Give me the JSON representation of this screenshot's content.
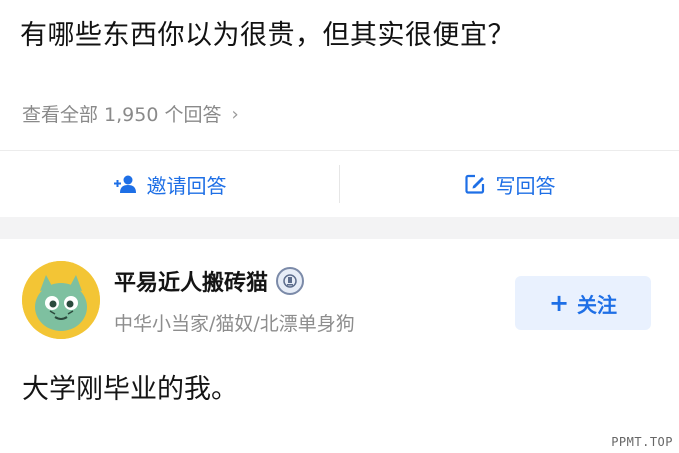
{
  "question": {
    "title": "有哪些东西你以为很贵，但其实很便宜？",
    "view_all": "查看全部 1,950 个回答",
    "chevron_icon": "chevron-right-icon"
  },
  "actions": {
    "invite": {
      "label": "邀请回答",
      "icon": "invite-user-icon"
    },
    "write": {
      "label": "写回答",
      "icon": "edit-icon"
    }
  },
  "answer": {
    "author_name": "平易近人搬砖猫",
    "author_bio": "中华小当家/猫奴/北漂单身狗",
    "follow_label": "关注",
    "content": "大学刚毕业的我。"
  },
  "colors": {
    "accent": "#1e6fe6",
    "follow_bg": "#e9f1fe",
    "muted": "#8a8a8a",
    "avatar_bg": "#f3c535"
  },
  "watermark": "PPMT.TOP"
}
